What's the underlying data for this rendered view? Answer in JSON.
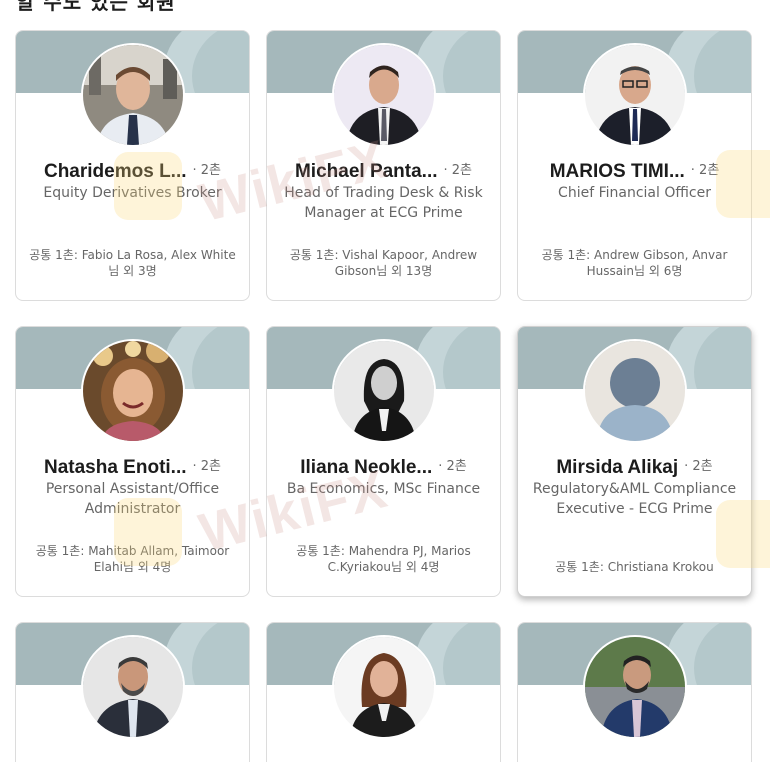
{
  "section": {
    "heading": "알 수도 있는 회원"
  },
  "watermark_text": "WikiFX",
  "people": [
    {
      "name": "Charidemos L...",
      "degree": "· 2촌",
      "title": "Equity Derivatives Broker",
      "mutual": "공통 1촌: Fabio La Rosa, Alex White님 외 3명",
      "avatar_icon": "profile-photo"
    },
    {
      "name": "Michael Panta...",
      "degree": "· 2촌",
      "title": "Head of Trading Desk & Risk Manager at ECG Prime",
      "mutual": "공통 1촌: Vishal Kapoor, Andrew Gibson님 외 13명",
      "avatar_icon": "profile-photo"
    },
    {
      "name": "MARIOS TIMI...",
      "degree": "· 2촌",
      "title": "Chief Financial Officer",
      "mutual": "공통 1촌: Andrew Gibson, Anvar Hussain님 외 6명",
      "avatar_icon": "profile-photo"
    },
    {
      "name": "Natasha Enoti...",
      "degree": "· 2촌",
      "title": "Personal Assistant/Office Administrator",
      "mutual": "공통 1촌: Mahitab Allam, Taimoor Elahi님 외 4명",
      "avatar_icon": "profile-photo"
    },
    {
      "name": "Iliana Neokle...",
      "degree": "· 2촌",
      "title": "Ba Economics, MSc Finance",
      "mutual": "공통 1촌: Mahendra PJ, Marios C.Kyriakou님 외 4명",
      "avatar_icon": "profile-photo"
    },
    {
      "name": "Mirsida Alikaj",
      "degree": "· 2촌",
      "title": "Regulatory&AML Compliance Executive - ECG Prime",
      "mutual": "공통 1촌: Christiana Krokou",
      "avatar_icon": "default-avatar-icon"
    },
    {
      "avatar_icon": "profile-photo"
    },
    {
      "avatar_icon": "profile-photo"
    },
    {
      "avatar_icon": "profile-photo"
    }
  ],
  "colors": {
    "banner": "#a5b8bb",
    "banner_highlight": "#c4d5d8",
    "name": "#1c1c1c",
    "secondary_text": "#666666"
  }
}
